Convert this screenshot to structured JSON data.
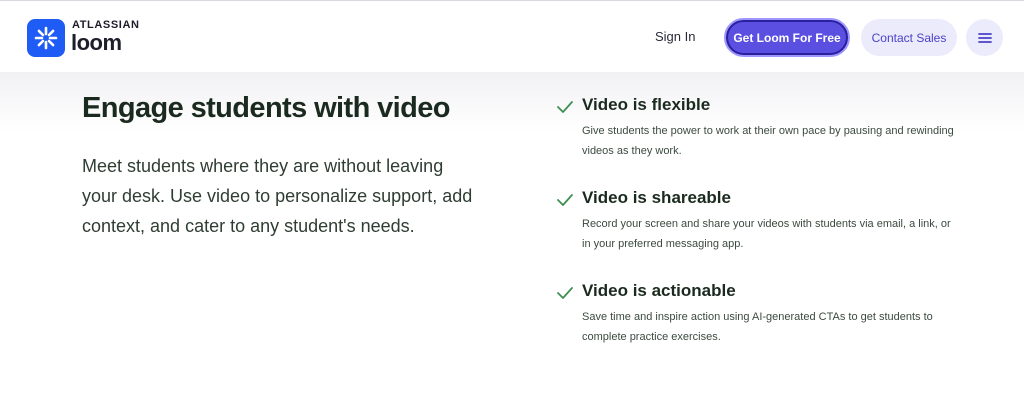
{
  "header": {
    "brand_top": "ATLASSIAN",
    "brand_main": "loom",
    "sign_in": "Sign In",
    "cta": "Get Loom For Free",
    "contact": "Contact Sales",
    "menu_icon": "hamburger-menu-icon"
  },
  "main": {
    "heading": "Engage students with video",
    "lead": "Meet students where they are without leaving your desk. Use video to personalize support, add context, and cater to any student's needs."
  },
  "features": [
    {
      "title": "Video is flexible",
      "description": "Give students the power to work at their own pace by pausing and rewinding videos as they work."
    },
    {
      "title": "Video is shareable",
      "description": "Record your screen and share your videos with students via email, a link, or in your preferred messaging app."
    },
    {
      "title": "Video is actionable",
      "description": "Save time and inspire action using AI-generated CTAs to get students to complete practice exercises."
    }
  ],
  "colors": {
    "brand_blue": "#1f5cf5",
    "cta_purple": "#5a4fe0",
    "check_green": "#3f8f52",
    "text_dark": "#1b2a1f"
  }
}
